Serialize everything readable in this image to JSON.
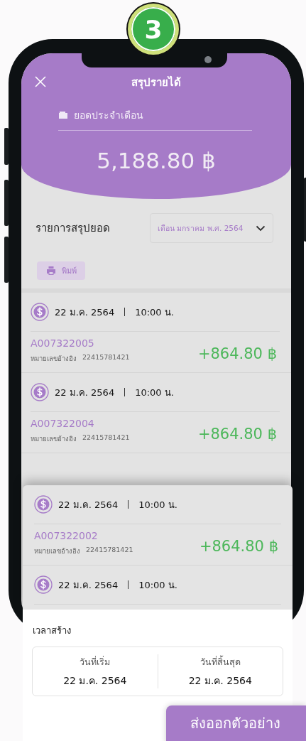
{
  "step_badge": "3",
  "header": {
    "title": "สรุปรายได้",
    "balance_label": "ยอดประจำเดือน",
    "balance": "5,188.80 ฿"
  },
  "summary": {
    "title": "รายการสรุปยอด",
    "month_select": "เดือน มกราคม พ.ศ. 2564",
    "print_button": "พิมพ์"
  },
  "transactions": [
    {
      "date": "22 ม.ค. 2564",
      "time": "10:00 น.",
      "id": "A007322005",
      "ref_label": "หมายเลขอ้างอิง",
      "ref": "22415781421",
      "amount": "+864.80 ฿"
    },
    {
      "date": "22 ม.ค. 2564",
      "time": "10:00 น.",
      "id": "A007322004",
      "ref_label": "หมายเลขอ้างอิง",
      "ref": "22415781421",
      "amount": "+864.80 ฿"
    }
  ],
  "highlighted_card": {
    "transaction": {
      "date": "22 ม.ค. 2564",
      "time": "10:00 น.",
      "id": "A007322002",
      "ref_label": "หมายเลขอ้างอิง",
      "ref": "22415781421",
      "amount": "+864.80 ฿"
    },
    "next_date": "22 ม.ค. 2564",
    "next_time": "10:00 น."
  },
  "bottom_sheet": {
    "title": "เวลาสร้าง",
    "start_label": "วันที่เริ่ม",
    "start_date": "22 ม.ค. 2564",
    "end_label": "วันที่สิ้นสุด",
    "end_date": "22 ม.ค. 2564"
  },
  "export_button": "ส่งออกตัวอย่าง"
}
